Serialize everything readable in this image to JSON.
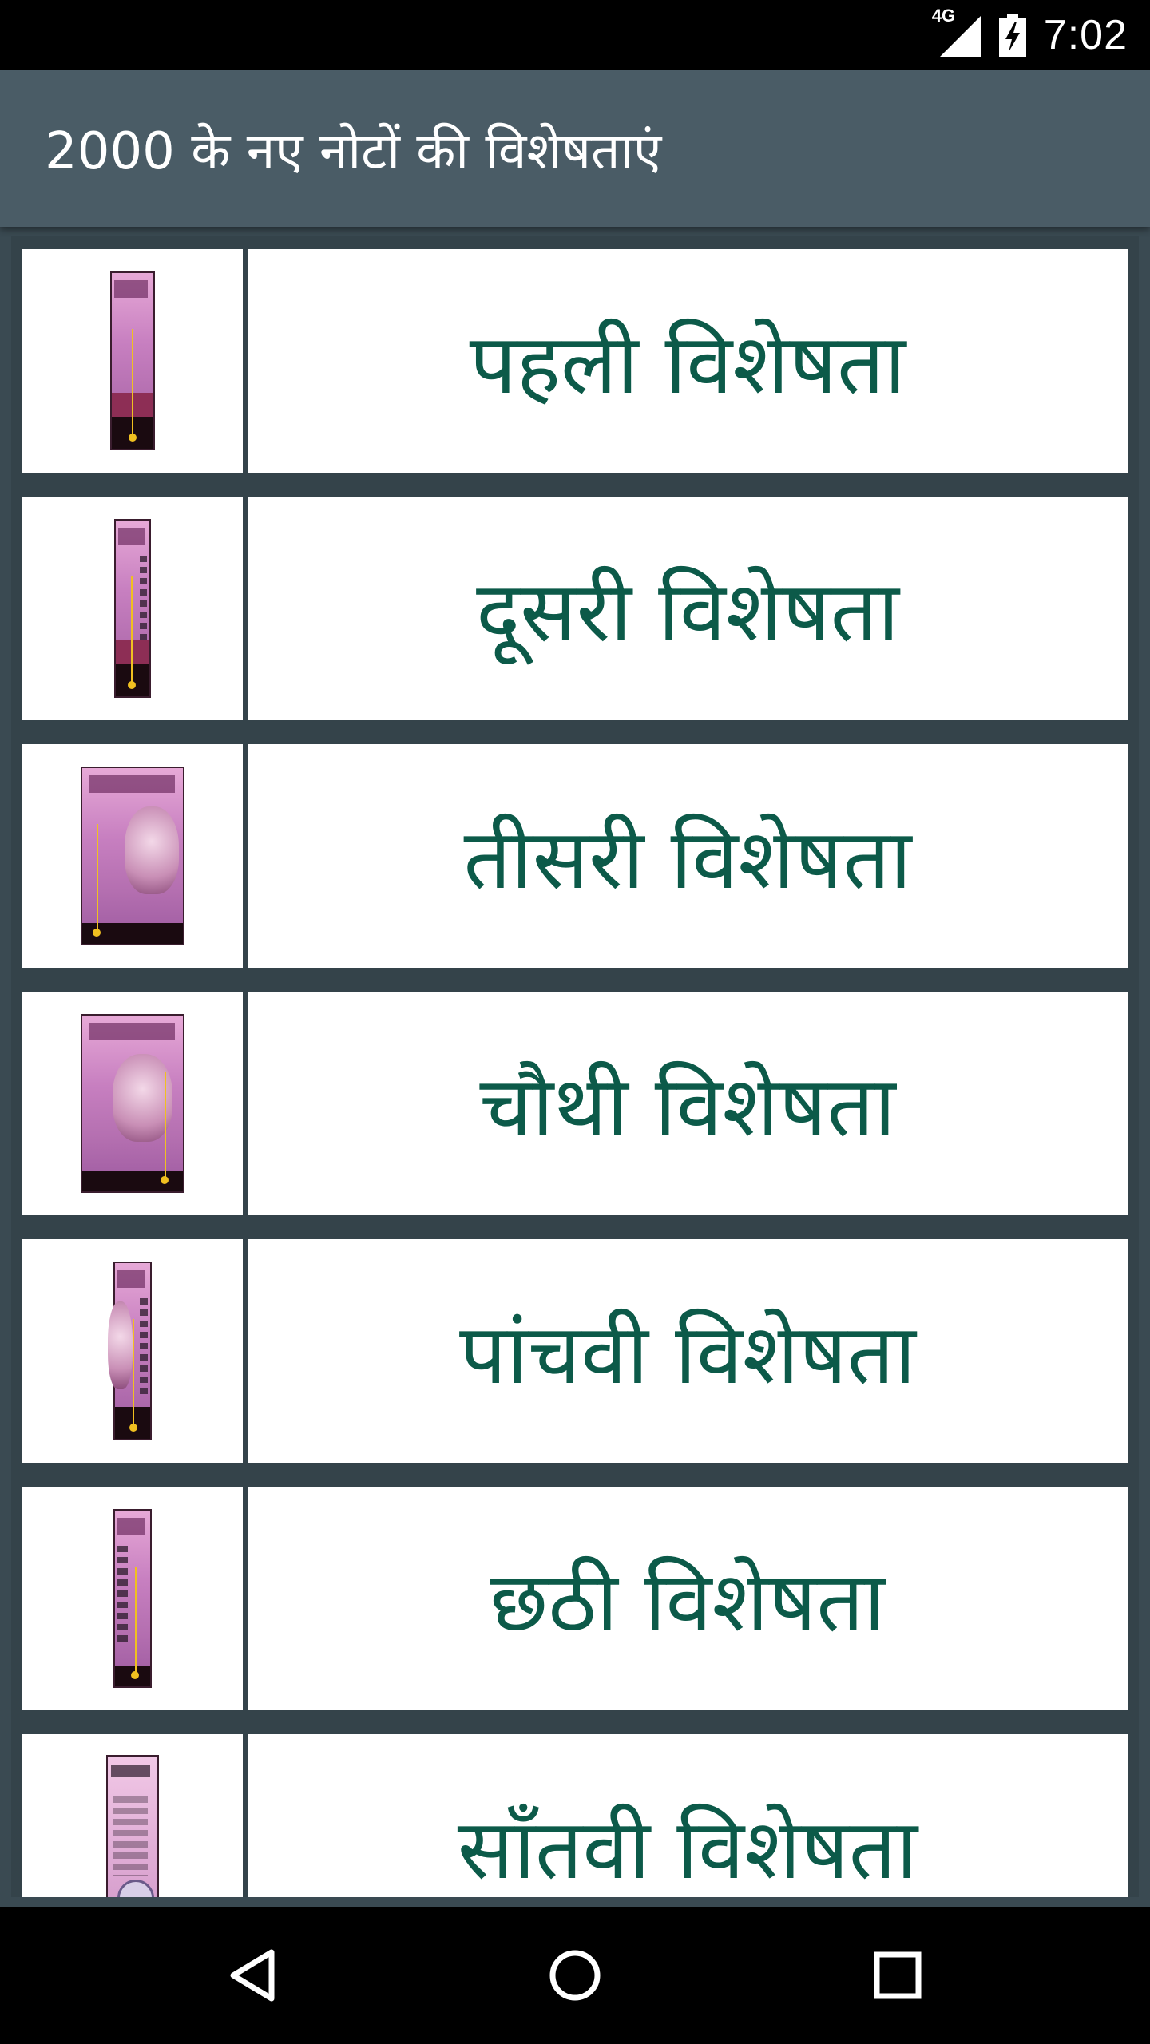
{
  "status_bar": {
    "network": "4G",
    "time": "7:02"
  },
  "app_bar": {
    "title": "2000 के नए नोटों की विशेषताएं"
  },
  "list": {
    "items": [
      {
        "label": "पहली विशेषता",
        "thumb": "note-feature-1"
      },
      {
        "label": "दूसरी विशेषता",
        "thumb": "note-feature-2"
      },
      {
        "label": "तीसरी विशेषता",
        "thumb": "note-feature-3"
      },
      {
        "label": "चौथी विशेषता",
        "thumb": "note-feature-4"
      },
      {
        "label": "पांचवी विशेषता",
        "thumb": "note-feature-5"
      },
      {
        "label": "छठी विशेषता",
        "thumb": "note-feature-6"
      },
      {
        "label": "साँतवी विशेषता",
        "thumb": "note-feature-7"
      }
    ]
  },
  "nav_bar": {
    "back_icon": "back-triangle-icon",
    "home_icon": "home-circle-icon",
    "recents_icon": "recents-square-icon"
  },
  "colors": {
    "app_bar": "#4a5c66",
    "list_bg": "#34434a",
    "label_text": "#0c5a49",
    "note_pink": "#c77fc0"
  }
}
